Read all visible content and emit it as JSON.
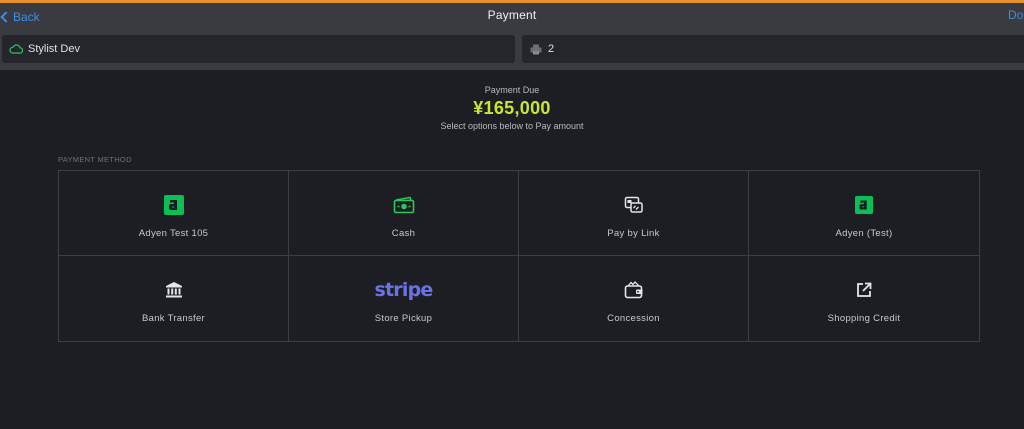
{
  "nav": {
    "back_label": "Back",
    "title": "Payment",
    "done_label": "Done"
  },
  "toolbar": {
    "store": {
      "label": "Stylist Dev",
      "icon": "cloud-icon"
    },
    "printer": {
      "value": "2",
      "icon": "printer-icon"
    }
  },
  "payment": {
    "due_label": "Payment Due",
    "amount": "¥165,000",
    "hint": "Select options below to Pay amount"
  },
  "methods": {
    "section_label": "PAYMENT METHOD",
    "items": [
      {
        "label": "Adyen Test 105",
        "icon": "adyen-logo-icon"
      },
      {
        "label": "Cash",
        "icon": "cash-icon"
      },
      {
        "label": "Pay by Link",
        "icon": "pay-by-link-icon"
      },
      {
        "label": "Adyen (Test)",
        "icon": "adyen-logo-icon"
      },
      {
        "label": "Bank Transfer",
        "icon": "bank-icon"
      },
      {
        "label": "Store Pickup",
        "icon": "stripe-logo-icon",
        "logo_text": "stripe"
      },
      {
        "label": "Concession",
        "icon": "wallet-icon"
      },
      {
        "label": "Shopping Credit",
        "icon": "external-link-icon"
      }
    ]
  },
  "colors": {
    "accent_bar": "#e8902a",
    "link_blue": "#3b8ee8",
    "amount_green": "#c5e830",
    "adyen_green": "#0abf53",
    "stripe_purple": "#6a72e6"
  }
}
